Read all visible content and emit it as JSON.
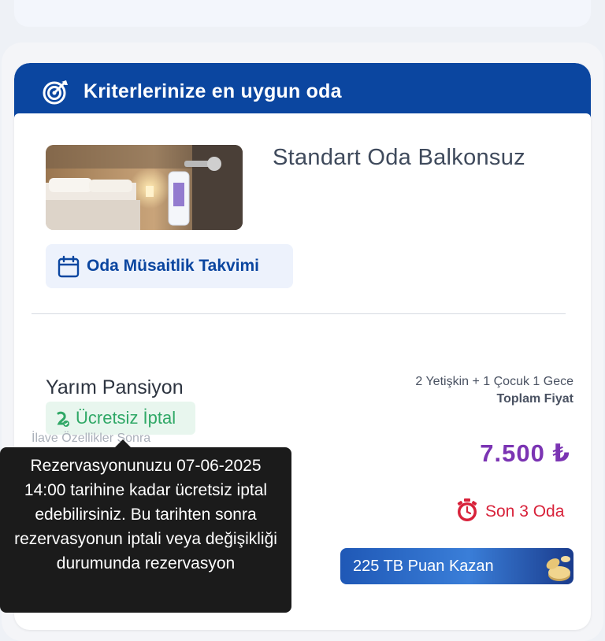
{
  "header": {
    "title": "Kriterlerinize en uygun oda",
    "icon": "target-icon"
  },
  "room": {
    "name": "Standart Oda Balkonsuz",
    "photo_icon": "room-photo-image",
    "calendar_button": {
      "label": "Oda Müsaitlik Takvimi",
      "icon": "calendar-icon"
    }
  },
  "offer": {
    "board_type": "Yarım Pansiyon",
    "free_cancel": {
      "label": "Ücretsiz İptal",
      "icon": "refund-icon",
      "color": "#2fa866"
    },
    "guests": "2 Yetişkin + 1 Çocuk 1 Gece",
    "total_label": "Toplam Fiyat",
    "price": "7.500 ₺",
    "price_color": "#7b34b3",
    "stock": {
      "label": "Son 3 Oda",
      "icon": "stopwatch-icon",
      "color": "#d8223a"
    },
    "points_button": {
      "label": "225 TB Puan Kazan",
      "icon": "coins-icon"
    },
    "hidden_text": "İlave Özellikler Sonra"
  },
  "tooltip": {
    "text": "Rezervasyonunuzu 07-06-2025 14:00 tarihine kadar ücretsiz iptal edebilirsiniz. Bu tarihten sonra rezervasyonun iptali veya değişikliği durumunda rezervasyon"
  },
  "colors": {
    "brand": "#0b46a0",
    "page_bg": "#eef1f6"
  }
}
